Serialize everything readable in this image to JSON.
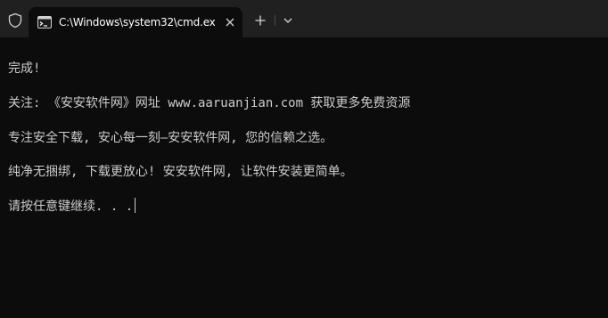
{
  "tab": {
    "title": "C:\\Windows\\system32\\cmd.ex"
  },
  "icons": {
    "shield": "shield-icon",
    "tab": "command-prompt-icon",
    "close": "close-icon",
    "new_tab": "plus-icon",
    "dropdown": "chevron-down-icon"
  },
  "colors": {
    "background": "#0c0c0c",
    "tabbar": "#202020",
    "text": "#cccccc"
  },
  "terminal": {
    "lines": [
      "完成!",
      "关注: 《安安软件网》网址 www.aaruanjian.com 获取更多免费资源",
      "专注安全下载, 安心每一刻—安安软件网, 您的信赖之选。",
      "纯净无捆绑, 下载更放心! 安安软件网, 让软件安装更简单。",
      "请按任意键继续. . ."
    ]
  }
}
